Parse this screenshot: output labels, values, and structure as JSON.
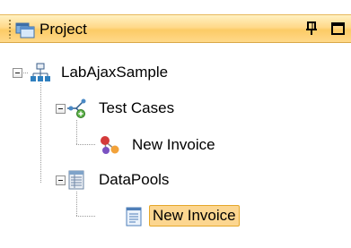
{
  "panel": {
    "title": "Project",
    "title_icon": "project-icon",
    "controls": [
      {
        "name": "pin-icon"
      },
      {
        "name": "maximize-icon"
      }
    ]
  },
  "tree": {
    "root": {
      "label": "LabAjaxSample",
      "icon": "network-project-icon",
      "expanded": true
    },
    "children": [
      {
        "label": "Test Cases",
        "icon": "test-cases-icon",
        "expanded": true,
        "children": [
          {
            "label": "New Invoice",
            "icon": "test-case-icon"
          }
        ]
      },
      {
        "label": "DataPools",
        "icon": "datapools-icon",
        "expanded": true,
        "children": [
          {
            "label": "New Invoice",
            "icon": "document-icon",
            "selected": true
          }
        ]
      }
    ]
  },
  "colors": {
    "titlebar_gradient": "#fccb66",
    "selection_fill": "#fcd690",
    "selection_border": "#e5a72a"
  }
}
